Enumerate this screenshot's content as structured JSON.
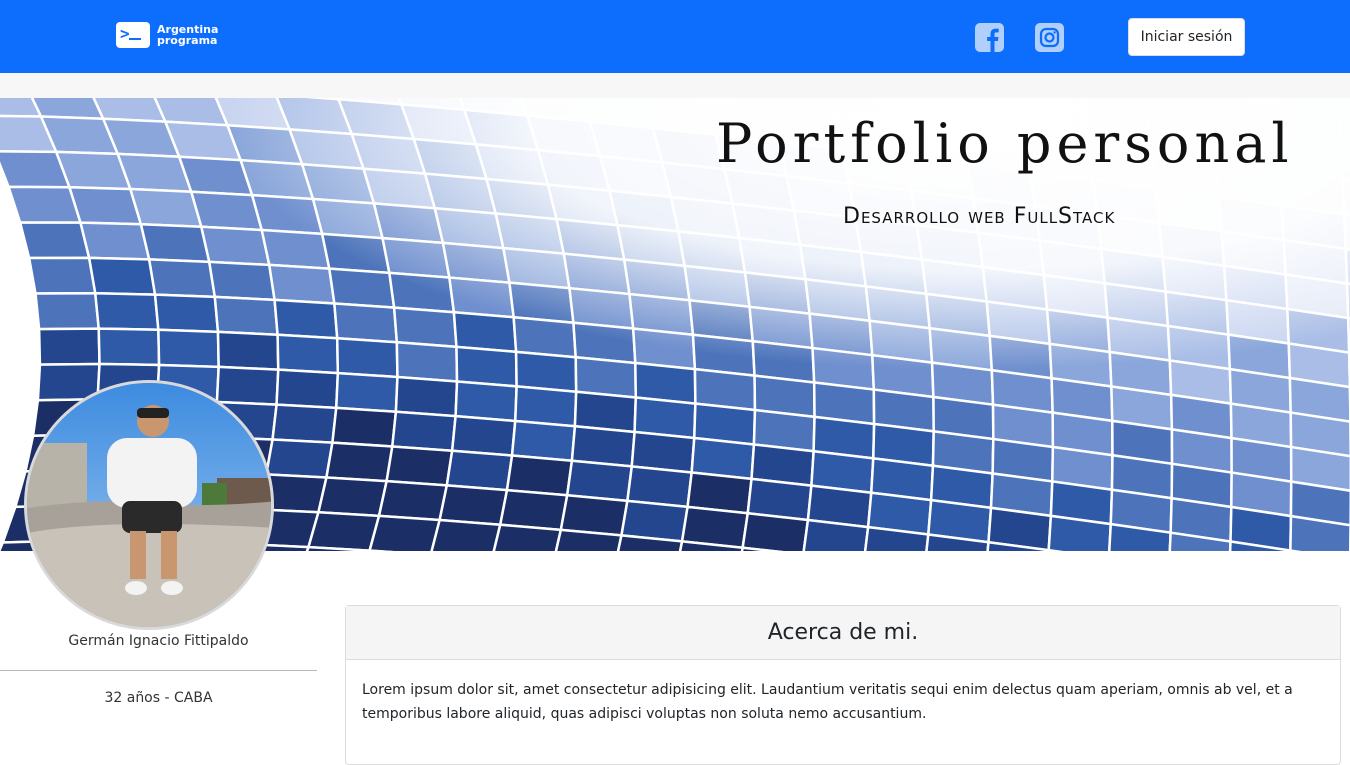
{
  "navbar": {
    "brand": {
      "line1": "Argentina",
      "line2": "programa",
      "icon": "terminal-icon"
    },
    "social": [
      {
        "name": "facebook",
        "icon": "facebook-icon"
      },
      {
        "name": "instagram",
        "icon": "instagram-icon"
      }
    ],
    "login_label": "Iniciar sesión",
    "color": "#0d6efd"
  },
  "banner": {
    "title": "Portfolio personal",
    "subtitle": "Desarrollo web FullStack"
  },
  "profile": {
    "name": "Germán Ignacio Fittipaldo",
    "details": "32 años - CABA"
  },
  "about": {
    "title": "Acerca de mi.",
    "text": "Lorem ipsum dolor sit, amet consectetur adipisicing elit. Laudantium veritatis sequi enim delectus quam aperiam, omnis ab vel, et a temporibus labore aliquid, quas adipisci voluptas non soluta nemo accusantium."
  }
}
